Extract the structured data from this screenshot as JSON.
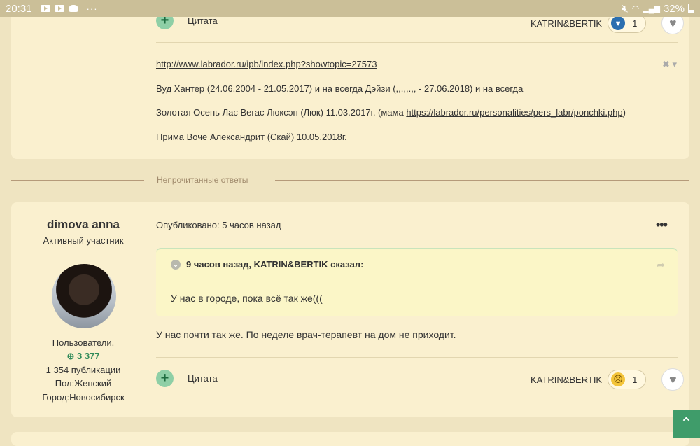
{
  "status_bar": {
    "time": "20:31",
    "more": "···",
    "battery": "32%"
  },
  "post1": {
    "quote_label": "Цитата",
    "reaction_user": "KATRIN&BERTIK",
    "reaction_count": "1",
    "signature": {
      "link1": "http://www.labrador.ru/ipb/index.php?showtopic=27573",
      "line2": "Вуд Хантер (24.06.2004 - 21.05.2017) и на всегда Дэйзи (,,.,,.,, - 27.06.2018) и на всегда",
      "line3_prefix": "Золотая Осень Лас Вегас Люксэн (Люк) 11.03.2017г. (мама ",
      "line3_link": "https://labrador.ru/personalities/pers_labr/ponchki.php",
      "line3_suffix": ")",
      "line4": "Прима Воче Александрит (Скай) 10.05.2018г."
    }
  },
  "unread_label": "Непрочитанные ответы",
  "post2": {
    "author": {
      "name": "dimova anna",
      "rank": "Активный участник",
      "group": "Пользователи.",
      "reputation": "3 377",
      "posts": "1 354 публикации",
      "gender": "Пол:Женский",
      "city": "Город:Новосибирск"
    },
    "published": "Опубликовано: 5 часов назад",
    "more_label": "•••",
    "quote": {
      "header": "9 часов назад, KATRIN&BERTIK сказал:",
      "body": "У нас в городе, пока всё так же((("
    },
    "text": "У нас почти так же. По неделе врач-терапевт на дом не приходит.",
    "quote_label": "Цитата",
    "reaction_user": "KATRIN&BERTIK",
    "reaction_count": "1"
  },
  "colors": {
    "background": "#efe4c1",
    "card": "#faf0cf",
    "accent_green": "#3f9c6a",
    "reputation_green": "#2f8a58"
  }
}
